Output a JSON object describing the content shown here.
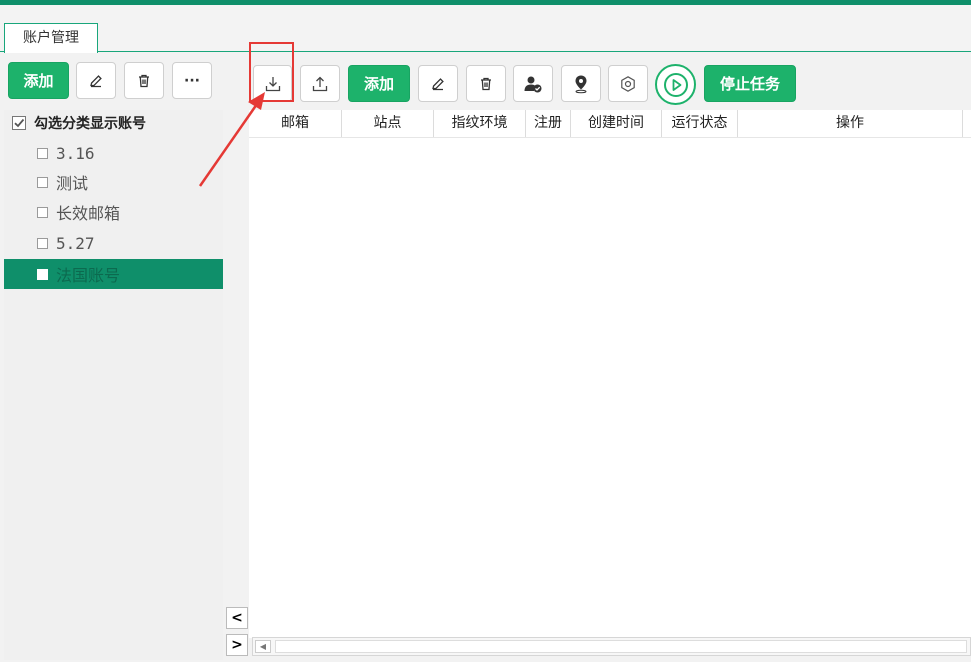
{
  "tab": {
    "label": "账户管理"
  },
  "left_toolbar": {
    "add_label": "添加",
    "more_label": "···"
  },
  "right_toolbar": {
    "add_label": "添加",
    "stop_label": "停止任务"
  },
  "tree": {
    "header": "勾选分类显示账号",
    "items": [
      {
        "label": "3.16"
      },
      {
        "label": "测试"
      },
      {
        "label": "长效邮箱"
      },
      {
        "label": "5.27"
      },
      {
        "label": "法国账号"
      }
    ]
  },
  "table": {
    "columns": [
      "邮箱",
      "站点",
      "指纹环境",
      "注册",
      "创建时间",
      "运行状态",
      "操作"
    ]
  },
  "nav": {
    "collapse_label": "<",
    "expand_label": ">"
  },
  "colors": {
    "accent": "#0f8f6a",
    "button_green": "#1db26b",
    "annotation_red": "#e53935"
  },
  "icons": [
    "edit-icon",
    "delete-icon",
    "more-icon",
    "import-icon",
    "export-icon",
    "user-check-icon",
    "location-icon",
    "settings-icon",
    "play-icon"
  ]
}
